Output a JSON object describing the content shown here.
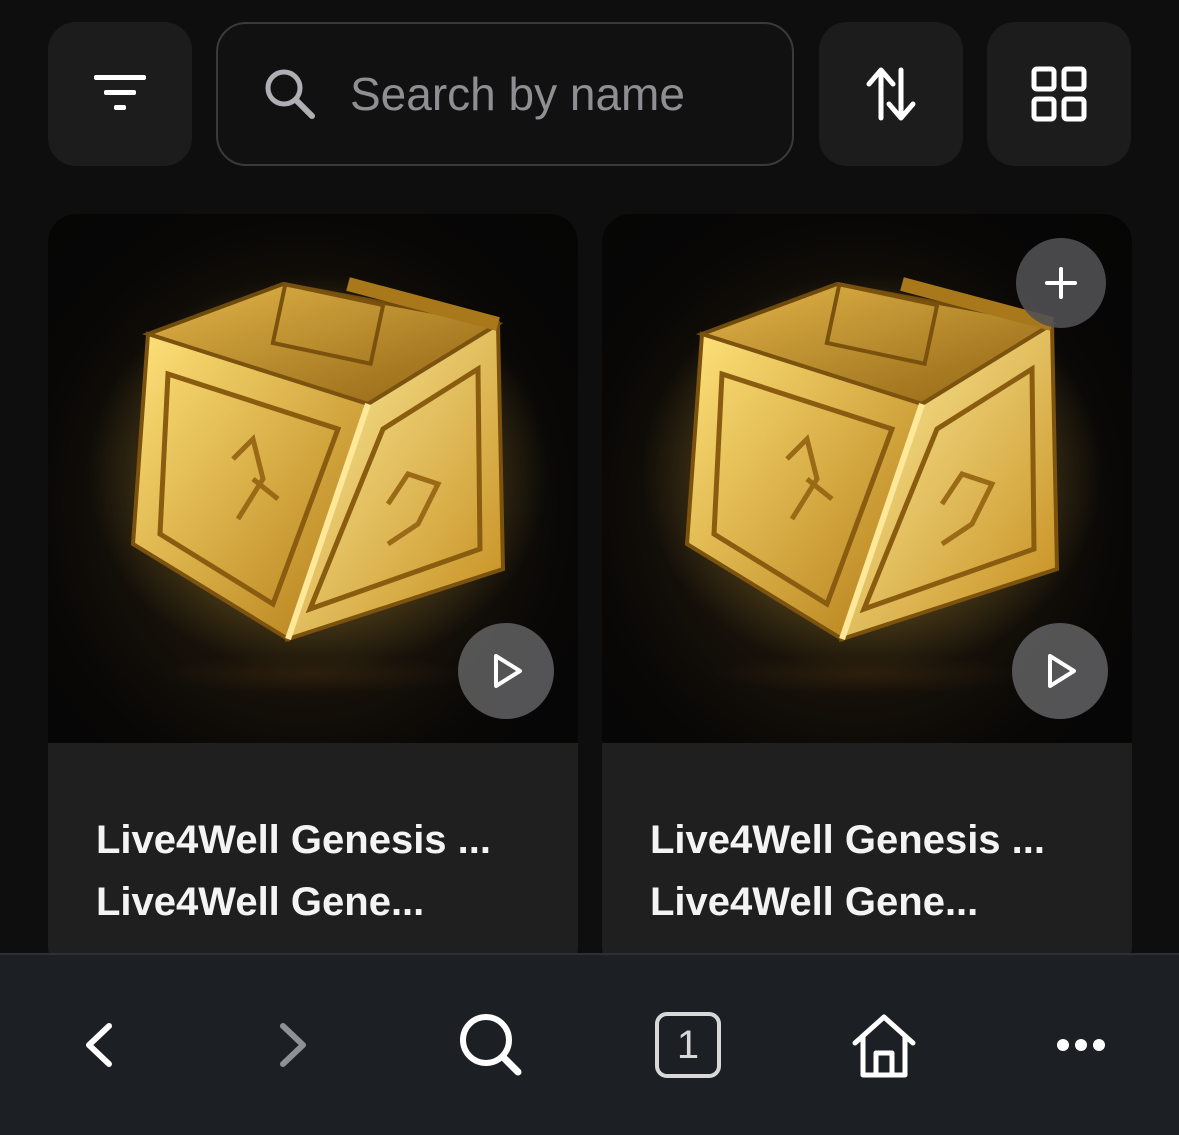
{
  "toolbar": {
    "filter_icon": "filter-icon",
    "search_placeholder": "Search by name",
    "search_value": "",
    "sort_icon": "sort-arrows-icon",
    "grid_icon": "grid-view-icon"
  },
  "cards": [
    {
      "title_line1": "Live4Well Genesis ...",
      "title_line2": "Live4Well Gene...",
      "has_add": false
    },
    {
      "title_line1": "Live4Well Genesis ...",
      "title_line2": "Live4Well Gene...",
      "has_add": true
    }
  ],
  "bottom_nav": {
    "back": "chevron-left-icon",
    "forward": "chevron-right-icon",
    "search": "search-icon",
    "tab_count": "1",
    "home": "home-icon",
    "more": "more-icon"
  },
  "colors": {
    "background": "#0e0e0f",
    "button_bg": "#1c1c1d",
    "card_bg": "#1f1f20",
    "bottom_bar": "#1c1f23",
    "gold": "#e8b83a"
  }
}
